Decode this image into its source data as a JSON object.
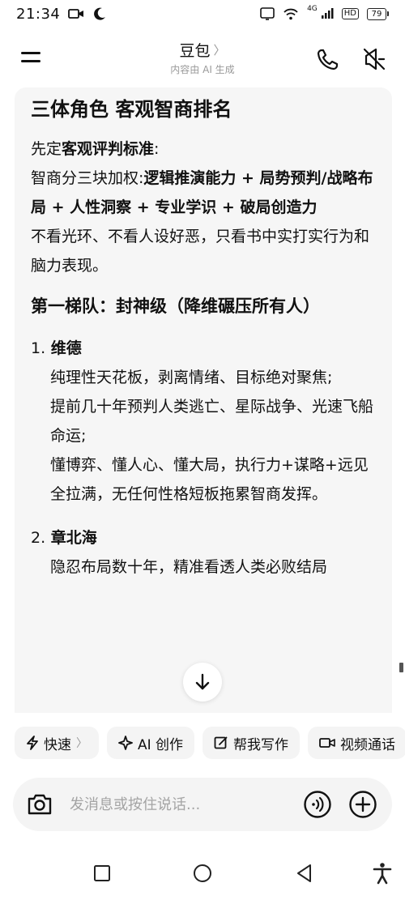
{
  "status_bar": {
    "time": "21:34",
    "network": "4G",
    "hd": "HD",
    "battery": "79"
  },
  "header": {
    "title": "豆包",
    "chevron": "〉",
    "subtitle": "内容由 AI 生成"
  },
  "message": {
    "heading": "三体角色 客观智商排名",
    "intro_prefix": "先定",
    "intro_bold": "客观评判标准",
    "intro_suffix": ":",
    "criteria_prefix": "智商分三块加权:",
    "criteria_bold": "逻辑推演能力 + 局势预判/战略布局 + 人性洞察 + 专业学识 + 破局创造力",
    "principle": "不看光环、不看人设好恶，只看书中实打实行为和脑力表现。",
    "tier1_heading": "第一梯队：封神级（降维碾压所有人）",
    "items": [
      {
        "number": "1.",
        "name": "维德",
        "lines": [
          "纯理性天花板，剥离情绪、目标绝对聚焦;",
          "提前几十年预判人类逃亡、星际战争、光速飞船命运;",
          "懂博弈、懂人心、懂大局，执行力+谋略+远见全拉满，无任何性格短板拖累智商发挥。"
        ]
      },
      {
        "number": "2.",
        "name": "章北海",
        "lines": [
          "隐忍布局数十年，精准看透人类必败结局"
        ]
      }
    ]
  },
  "chips": [
    {
      "icon": "lightning-icon",
      "label": "快速",
      "chevron": "〉"
    },
    {
      "icon": "sparkle-icon",
      "label": "AI 创作"
    },
    {
      "icon": "edit-icon",
      "label": "帮我写作"
    },
    {
      "icon": "video-icon",
      "label": "视频通话"
    }
  ],
  "input": {
    "placeholder": "发消息或按住说话..."
  },
  "colors": {
    "bubble_bg": "#f6f6f6",
    "chip_bg": "#f4f4f4",
    "placeholder": "#a4a4a4",
    "subtitle": "#9a9a9a"
  }
}
